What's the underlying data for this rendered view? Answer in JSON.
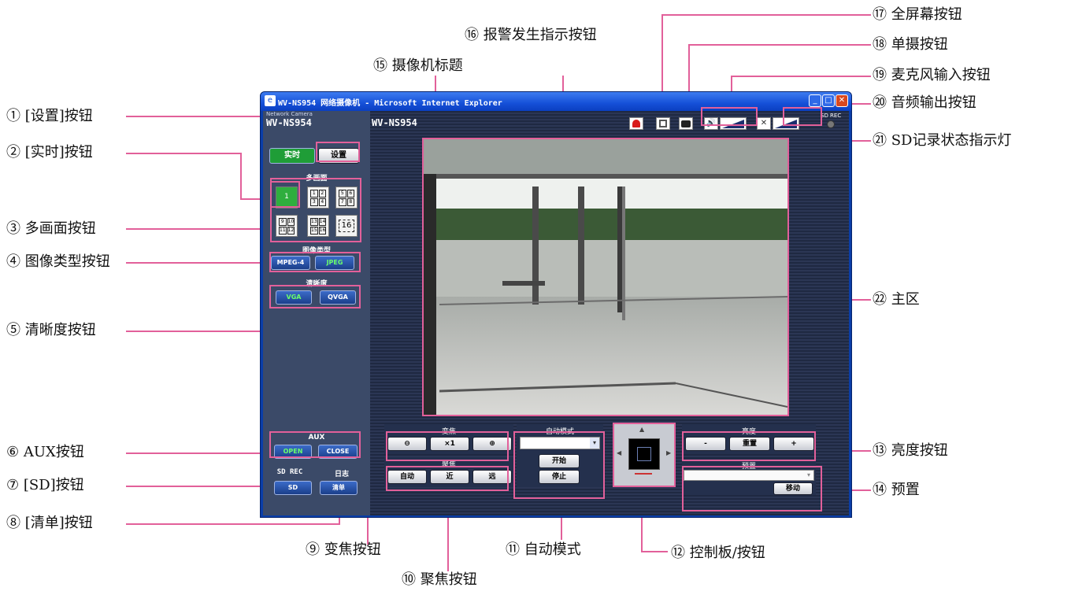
{
  "window": {
    "title": "WV-NS954 网络摄像机 - Microsoft Internet Explorer",
    "logo_small": "Network Camera",
    "model": "WV-NS954",
    "camera_title": "WV-NS954",
    "sd_rec_label": "SD REC"
  },
  "nav": {
    "live_label": "实时",
    "setup_label": "设置"
  },
  "multiscreen": {
    "title": "多画面",
    "single_label": "1",
    "quad_a": [
      "1",
      "2",
      "3",
      "4"
    ],
    "quad_b": [
      "5",
      "6",
      "7",
      "8"
    ],
    "quad_c": [
      "9",
      "10",
      "11",
      "12"
    ],
    "quad_d": [
      "13",
      "14",
      "15",
      "16"
    ],
    "sixteen_label": "16"
  },
  "image_type": {
    "title": "图像类型",
    "mpeg4_label": "MPEG-4",
    "jpeg_label": "JPEG"
  },
  "resolution": {
    "title": "清晰度",
    "vga_label": "VGA",
    "qvga_label": "QVGA"
  },
  "aux": {
    "title": "AUX",
    "open_label": "OPEN",
    "close_label": "CLOSE"
  },
  "sd_log": {
    "sd_title": "SD REC",
    "log_title": "日志",
    "sd_label": "SD",
    "list_label": "清单"
  },
  "zoom": {
    "title": "变焦",
    "zoom_out": "⊖",
    "x1": "×1",
    "zoom_in": "⊕"
  },
  "focus": {
    "title": "聚焦",
    "auto": "自动",
    "near": "近",
    "far": "远"
  },
  "auto_mode": {
    "title": "自动模式",
    "start": "开始",
    "stop": "停止"
  },
  "brightness": {
    "title": "亮度",
    "minus": "-",
    "reset": "重置",
    "plus": "+"
  },
  "preset": {
    "title": "预置",
    "move": "移动"
  },
  "colors": {
    "callout_line": "#e2609a",
    "live_active": "#1f9d37",
    "accent_green": "#6bff6b"
  },
  "callouts": [
    "① [设置]按钮",
    "② [实时]按钮",
    "③ 多画面按钮",
    "④ 图像类型按钮",
    "⑤ 清晰度按钮",
    "⑥ AUX按钮",
    "⑦ [SD]按钮",
    "⑧ [清单]按钮",
    "⑨ 变焦按钮",
    "⑩ 聚焦按钮",
    "⑪ 自动模式",
    "⑫ 控制板/按钮",
    "⑬ 亮度按钮",
    "⑭ 预置",
    "⑮ 摄像机标题",
    "⑯ 报警发生指示按钮",
    "⑰ 全屏幕按钮",
    "⑱ 单摄按钮",
    "⑲ 麦克风输入按钮",
    "⑳ 音频输出按钮",
    "㉑ SD记录状态指示灯",
    "㉒ 主区"
  ]
}
